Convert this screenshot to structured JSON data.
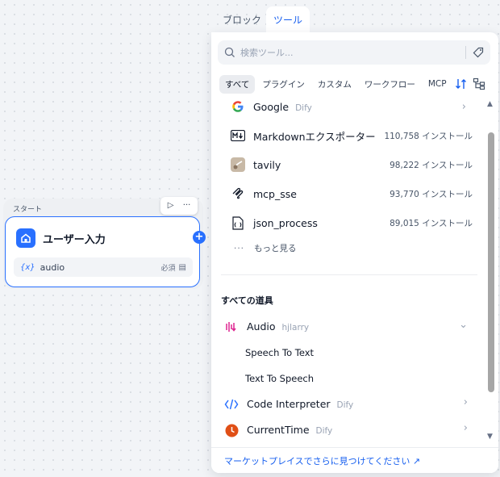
{
  "canvas": {
    "start_label": "スタート",
    "node": {
      "title": "ユーザー入力",
      "variable_icon": "{x}",
      "variable_name": "audio",
      "required_label": "必須",
      "actions": {
        "run_icon": "play-icon",
        "more_icon": "more-icon"
      }
    }
  },
  "tabs": {
    "block": "ブロック",
    "tool": "ツール"
  },
  "search": {
    "placeholder": "検索ツール..."
  },
  "filters": [
    "すべて",
    "プラグイン",
    "カスタム",
    "ワークフロー",
    "MCP"
  ],
  "featured_tools": [
    {
      "name": "Google",
      "author": "Dify",
      "count": "",
      "icon": "google-icon"
    },
    {
      "name": "Markdownエクスポーター",
      "author": "",
      "count": "110,758 インストール",
      "icon": "markdown-icon"
    },
    {
      "name": "tavily",
      "author": "",
      "count": "98,222 インストール",
      "icon": "tavily-icon"
    },
    {
      "name": "mcp_sse",
      "author": "",
      "count": "93,770 インストール",
      "icon": "mcp-icon"
    },
    {
      "name": "json_process",
      "author": "",
      "count": "89,015 インストール",
      "icon": "json-icon"
    }
  ],
  "more_label": "もっと見る",
  "all_tools_title": "すべての道具",
  "all_tools": [
    {
      "name": "Audio",
      "author": "hjlarry",
      "expanded": true,
      "icon": "audio-icon",
      "children": [
        "Speech To Text",
        "Text To Speech"
      ]
    },
    {
      "name": "Code Interpreter",
      "author": "Dify",
      "expanded": false,
      "icon": "code-icon",
      "children": []
    },
    {
      "name": "CurrentTime",
      "author": "Dify",
      "expanded": false,
      "icon": "clock-icon",
      "children": []
    }
  ],
  "footer": {
    "link": "マーケットプレイスでさらに見つけてください ↗"
  },
  "colors": {
    "accent": "#2970ff",
    "link": "#155eef"
  }
}
